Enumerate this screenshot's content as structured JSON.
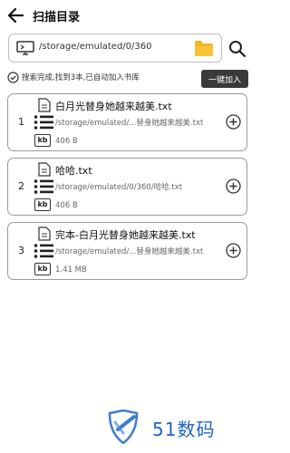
{
  "header": {
    "title": "扫描目录"
  },
  "path_bar": {
    "value": "/storage/emulated/0/360"
  },
  "status": {
    "text": "搜索完成,找到3本,已自动加入书库"
  },
  "add_all_label": "一键加入",
  "files": [
    {
      "index": "1",
      "name": "白月光替身她越来越美.txt",
      "path": "/storage/emulated/...替身她越来越美.txt",
      "size": "406 B"
    },
    {
      "index": "2",
      "name": "哈哈.txt",
      "path": "/storage/emulated/0/360/哈哈.txt",
      "size": "406 B"
    },
    {
      "index": "3",
      "name": "完本-白月光替身她越来越美.txt",
      "path": "/storage/emulated/...替身她越来越美.txt",
      "size": "1.41 MB"
    }
  ],
  "kb_label": "kb",
  "watermark": {
    "text": "51数码"
  },
  "icons": [
    "back-arrow-icon",
    "monitor-icon",
    "folder-icon",
    "search-icon",
    "check-circle-icon",
    "document-icon",
    "list-icon",
    "kb-icon",
    "add-circle-icon",
    "shield-logo-icon"
  ],
  "colors": {
    "button_bg": "#3a3a3a",
    "folder": "#f3b51c",
    "watermark": "#1e64c8"
  }
}
